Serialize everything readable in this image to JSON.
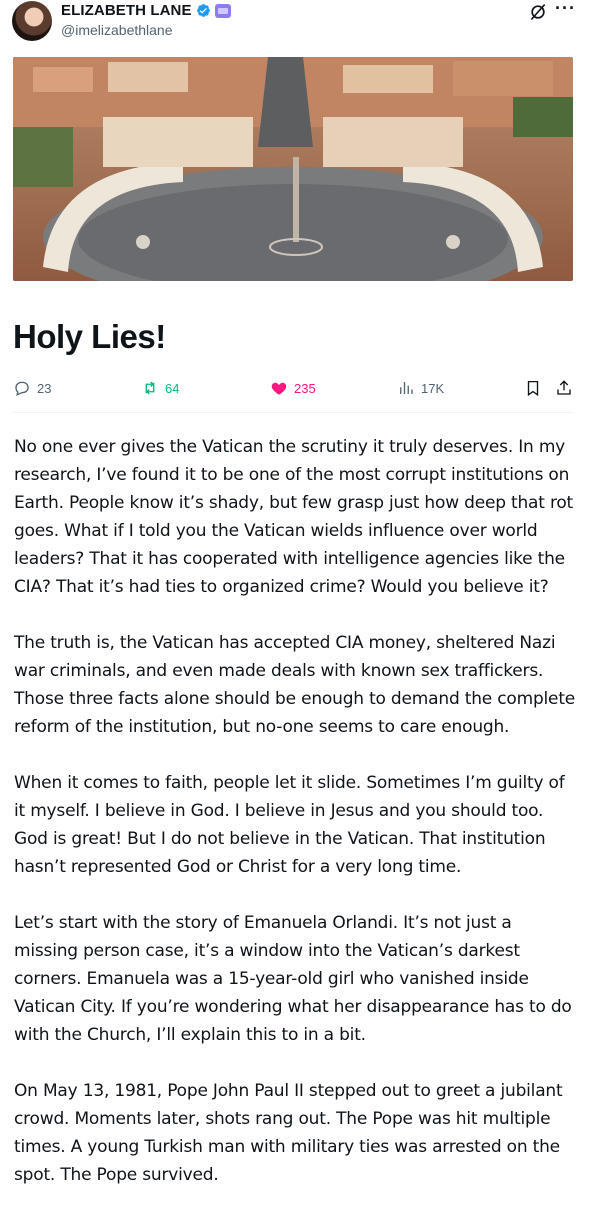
{
  "author": {
    "display_name": "ELIZABETH LANE",
    "handle": "@imelizabethlane",
    "verified_icon": "verified-badge-icon",
    "affiliation_icon": "affiliate-badge-icon"
  },
  "header_actions": {
    "grok_icon": "grok-icon",
    "more_icon": "more-icon",
    "more_label": "···"
  },
  "hero": {
    "description_icon": "vatican-aerial-photo"
  },
  "article": {
    "title": "Holy Lies!",
    "paragraphs": [
      "No one ever gives the Vatican the scrutiny it truly deserves. In my research, I’ve found it to be one of the most corrupt institutions on Earth. People know it’s shady, but few grasp just how deep that rot goes. What if I told you the Vatican wields influence over world leaders? That it has cooperated with intelligence agencies like the CIA? That it’s had ties to organized crime? Would you believe it?",
      "The truth is, the Vatican has accepted CIA money, sheltered Nazi war criminals, and even made deals with known sex traffickers. Those three facts alone should be enough to demand the complete reform of the institution, but no-one seems to care enough.",
      "When it comes to faith, people let it slide. Sometimes I’m guilty of it myself. I believe in God. I believe in Jesus and you should too. God is great! But I do not believe in the Vatican. That institution hasn’t represented God or Christ for a very long time.",
      "Let’s start with the story of Emanuela Orlandi. It’s not just a missing person case, it’s a window into the Vatican’s darkest corners. Emanuela was a 15-year-old girl who vanished inside Vatican City. If you’re wondering what her disappearance has to do with the Church, I’ll explain this to in a bit.",
      "On May 13, 1981, Pope John Paul II stepped out to greet a jubilant crowd. Moments later, shots rang out. The Pope was hit multiple times. A young Turkish man with military ties was arrested on the spot. The Pope survived."
    ]
  },
  "actions": {
    "replies": "23",
    "reposts": "64",
    "likes": "235",
    "views": "17K",
    "colors": {
      "repost": "#00ba7c",
      "like": "#f91880",
      "muted": "#536471"
    }
  }
}
